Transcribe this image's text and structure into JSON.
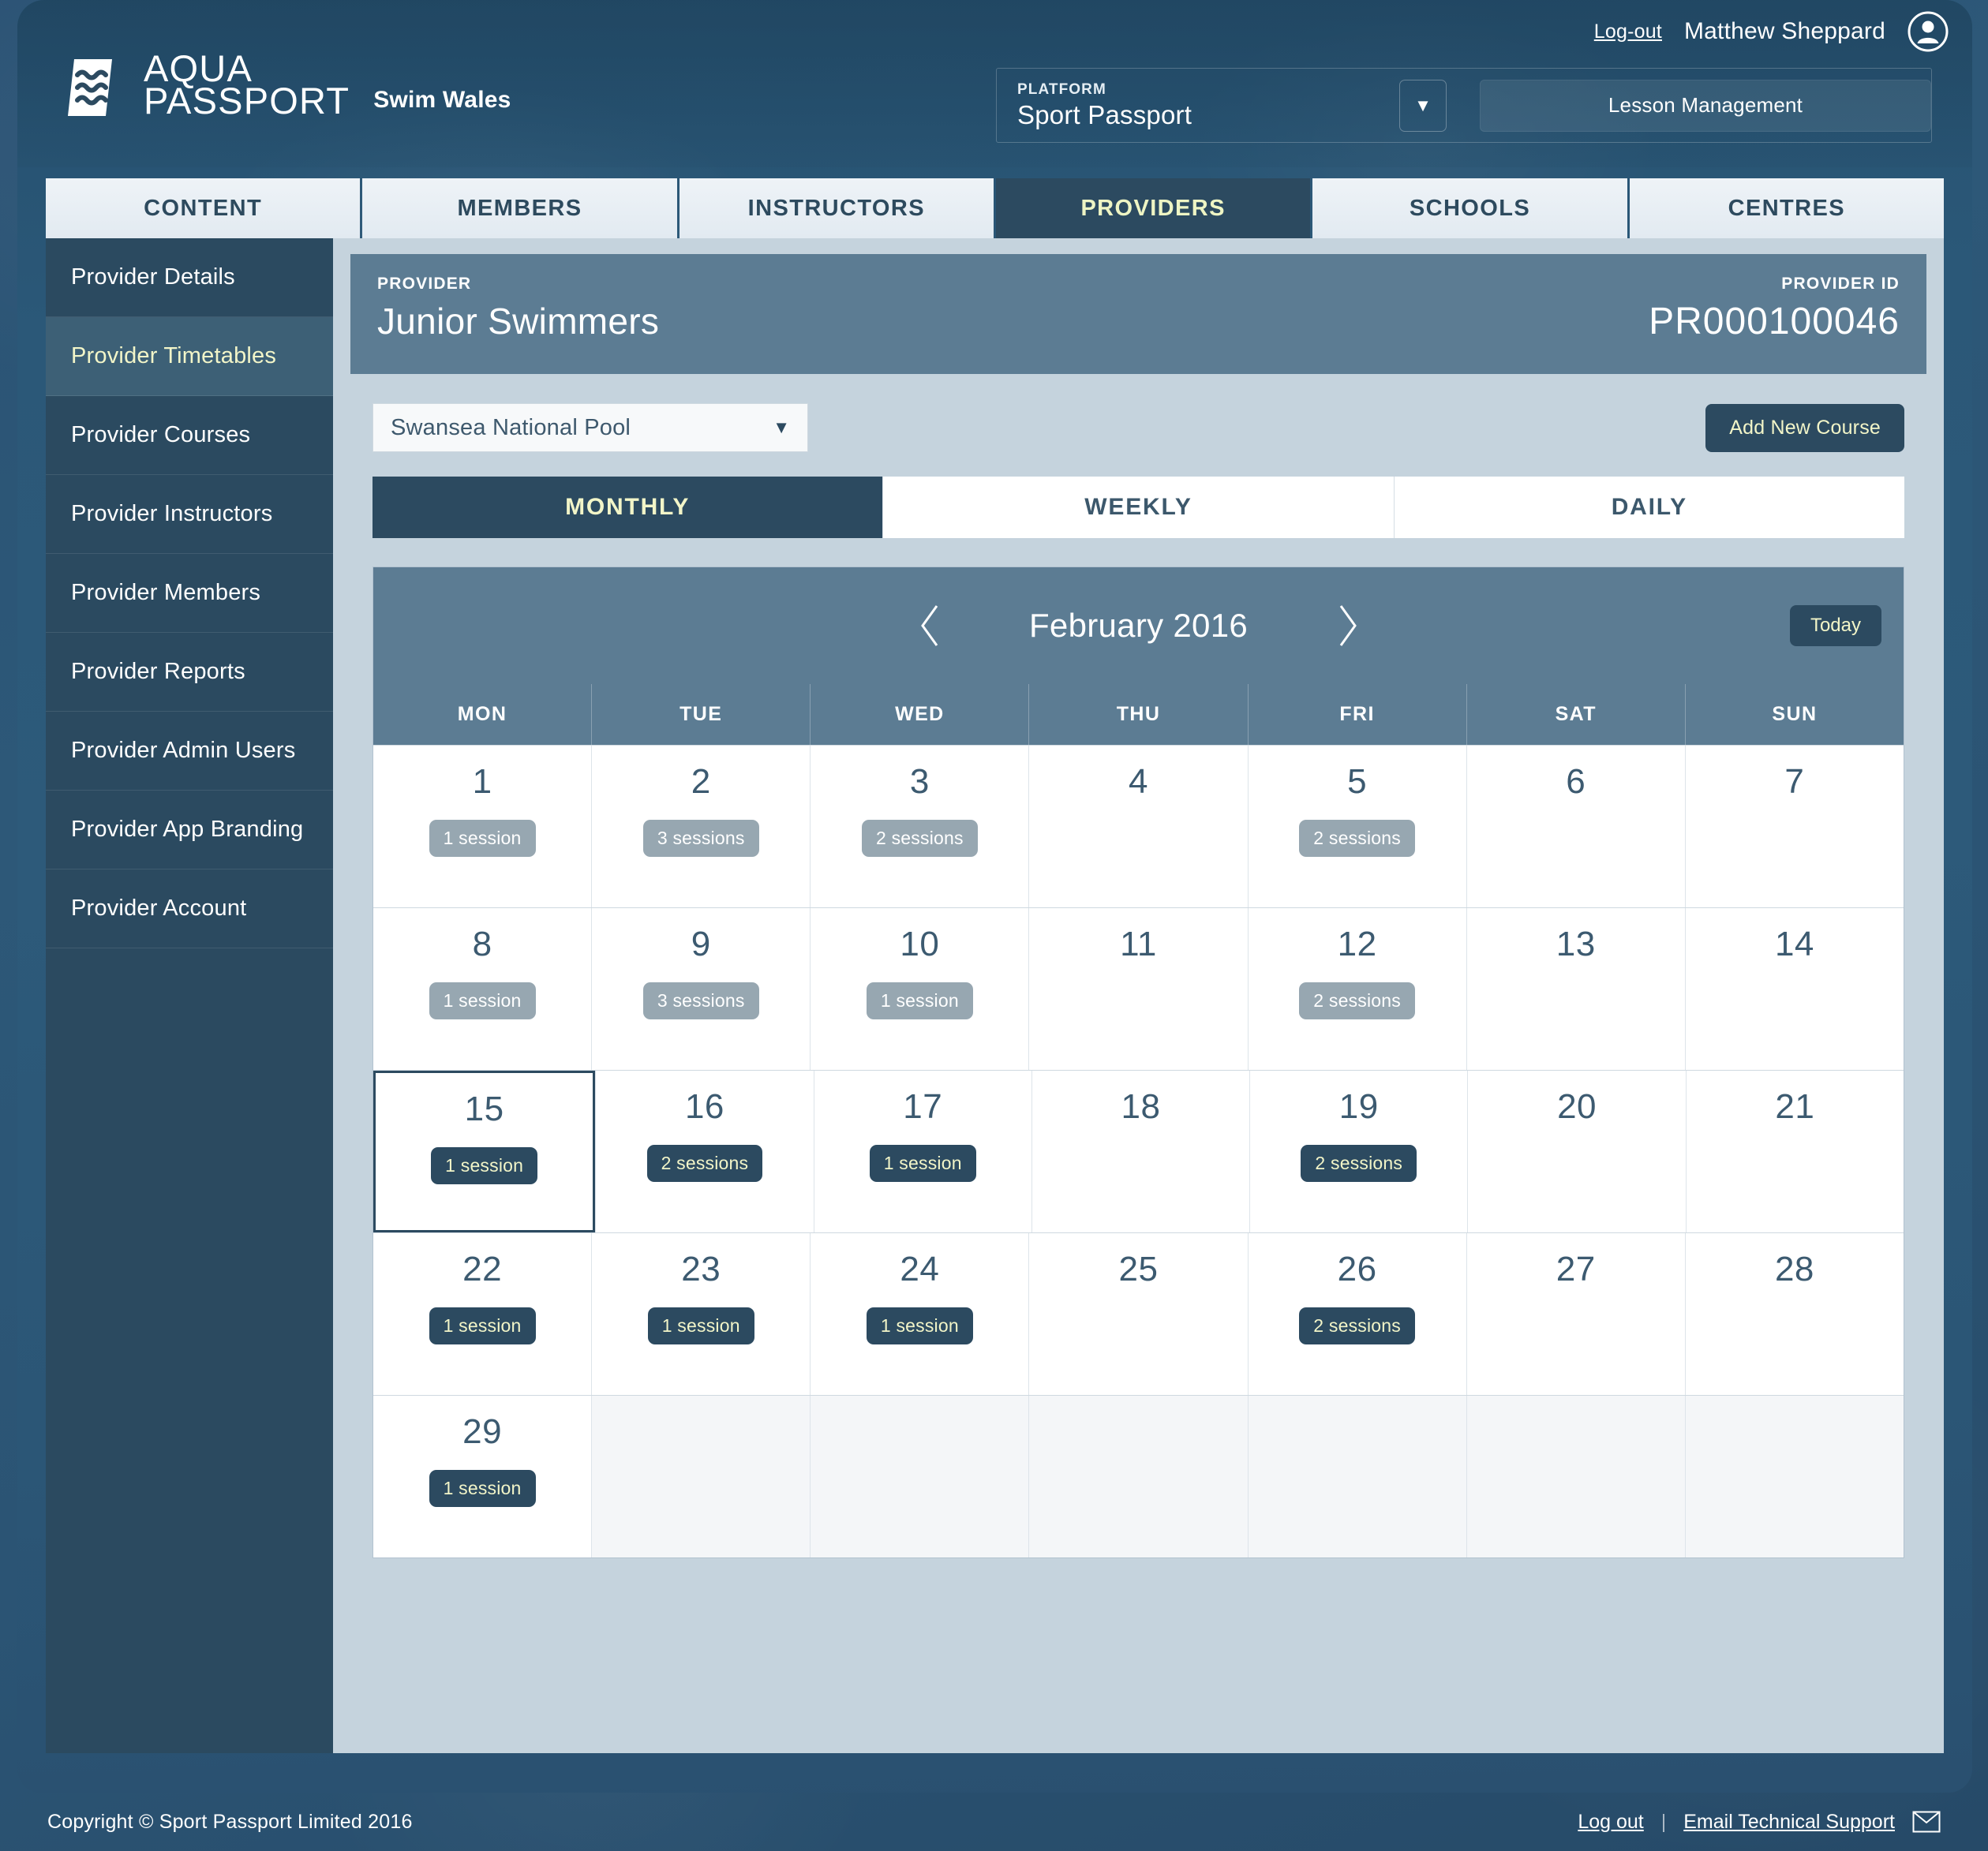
{
  "header": {
    "logout_label": "Log-out",
    "user_name": "Matthew Sheppard",
    "avatar_icon": "user-avatar-icon",
    "logo_line1": "AQUA",
    "logo_line2": "PASSPORT",
    "brand_sub": "Swim Wales",
    "platform_kicker": "PLATFORM",
    "platform_value": "Sport Passport",
    "platform_caret_icon": "chevron-down-icon",
    "lesson_button": "Lesson Management"
  },
  "tabs": [
    {
      "label": "CONTENT",
      "active": false
    },
    {
      "label": "MEMBERS",
      "active": false
    },
    {
      "label": "INSTRUCTORS",
      "active": false
    },
    {
      "label": "PROVIDERS",
      "active": true
    },
    {
      "label": "SCHOOLS",
      "active": false
    },
    {
      "label": "CENTRES",
      "active": false
    }
  ],
  "sidebar": {
    "items": [
      {
        "label": "Provider Details",
        "active": false
      },
      {
        "label": "Provider Timetables",
        "active": true
      },
      {
        "label": "Provider Courses",
        "active": false
      },
      {
        "label": "Provider Instructors",
        "active": false
      },
      {
        "label": "Provider Members",
        "active": false
      },
      {
        "label": "Provider Reports",
        "active": false
      },
      {
        "label": "Provider Admin Users",
        "active": false
      },
      {
        "label": "Provider App Branding",
        "active": false
      },
      {
        "label": "Provider Account",
        "active": false
      }
    ]
  },
  "provider": {
    "kicker": "PROVIDER",
    "name": "Junior Swimmers",
    "id_kicker": "PROVIDER ID",
    "id_value": "PR000100046"
  },
  "toolbar": {
    "pool_value": "Swansea National Pool",
    "pool_caret_icon": "chevron-down-icon",
    "add_course_label": "Add New Course"
  },
  "view_tabs": [
    {
      "label": "MONTHLY",
      "active": true
    },
    {
      "label": "WEEKLY",
      "active": false
    },
    {
      "label": "DAILY",
      "active": false
    }
  ],
  "calendar": {
    "prev_icon": "chevron-left-icon",
    "next_icon": "chevron-right-icon",
    "title": "February 2016",
    "today_label": "Today",
    "day_headers": [
      "MON",
      "TUE",
      "WED",
      "THU",
      "FRI",
      "SAT",
      "SUN"
    ],
    "weeks": [
      [
        {
          "day": "1",
          "sessions": "1 session",
          "style": "grey",
          "today": false
        },
        {
          "day": "2",
          "sessions": "3 sessions",
          "style": "grey",
          "today": false
        },
        {
          "day": "3",
          "sessions": "2 sessions",
          "style": "grey",
          "today": false
        },
        {
          "day": "4",
          "sessions": "",
          "style": "",
          "today": false
        },
        {
          "day": "5",
          "sessions": "2 sessions",
          "style": "grey",
          "today": false
        },
        {
          "day": "6",
          "sessions": "",
          "style": "",
          "today": false
        },
        {
          "day": "7",
          "sessions": "",
          "style": "",
          "today": false
        }
      ],
      [
        {
          "day": "8",
          "sessions": "1 session",
          "style": "grey",
          "today": false
        },
        {
          "day": "9",
          "sessions": "3 sessions",
          "style": "grey",
          "today": false
        },
        {
          "day": "10",
          "sessions": "1 session",
          "style": "grey",
          "today": false
        },
        {
          "day": "11",
          "sessions": "",
          "style": "",
          "today": false
        },
        {
          "day": "12",
          "sessions": "2 sessions",
          "style": "grey",
          "today": false
        },
        {
          "day": "13",
          "sessions": "",
          "style": "",
          "today": false
        },
        {
          "day": "14",
          "sessions": "",
          "style": "",
          "today": false
        }
      ],
      [
        {
          "day": "15",
          "sessions": "1 session",
          "style": "dark",
          "today": true
        },
        {
          "day": "16",
          "sessions": "2 sessions",
          "style": "dark",
          "today": false
        },
        {
          "day": "17",
          "sessions": "1 session",
          "style": "dark",
          "today": false
        },
        {
          "day": "18",
          "sessions": "",
          "style": "",
          "today": false
        },
        {
          "day": "19",
          "sessions": "2 sessions",
          "style": "dark",
          "today": false
        },
        {
          "day": "20",
          "sessions": "",
          "style": "",
          "today": false
        },
        {
          "day": "21",
          "sessions": "",
          "style": "",
          "today": false
        }
      ],
      [
        {
          "day": "22",
          "sessions": "1 session",
          "style": "dark",
          "today": false
        },
        {
          "day": "23",
          "sessions": "1 session",
          "style": "dark",
          "today": false
        },
        {
          "day": "24",
          "sessions": "1 session",
          "style": "dark",
          "today": false
        },
        {
          "day": "25",
          "sessions": "",
          "style": "",
          "today": false
        },
        {
          "day": "26",
          "sessions": "2 sessions",
          "style": "dark",
          "today": false
        },
        {
          "day": "27",
          "sessions": "",
          "style": "",
          "today": false
        },
        {
          "day": "28",
          "sessions": "",
          "style": "",
          "today": false
        }
      ],
      [
        {
          "day": "29",
          "sessions": "1 session",
          "style": "dark",
          "today": false
        },
        {
          "day": "",
          "sessions": "",
          "style": "",
          "today": false
        },
        {
          "day": "",
          "sessions": "",
          "style": "",
          "today": false
        },
        {
          "day": "",
          "sessions": "",
          "style": "",
          "today": false
        },
        {
          "day": "",
          "sessions": "",
          "style": "",
          "today": false
        },
        {
          "day": "",
          "sessions": "",
          "style": "",
          "today": false
        },
        {
          "day": "",
          "sessions": "",
          "style": "",
          "today": false
        }
      ]
    ]
  },
  "footer": {
    "copyright": "Copyright © Sport Passport Limited 2016",
    "logout_label": "Log out",
    "separator": "|",
    "support_label": "Email Technical Support",
    "mail_icon": "envelope-icon"
  },
  "colors": {
    "accent_yellow": "#f2f5c8",
    "dark_navy": "#2c4a60",
    "slate": "#5c7c93",
    "content_bg": "#c5d3dd",
    "badge_grey": "#97a7b1"
  }
}
